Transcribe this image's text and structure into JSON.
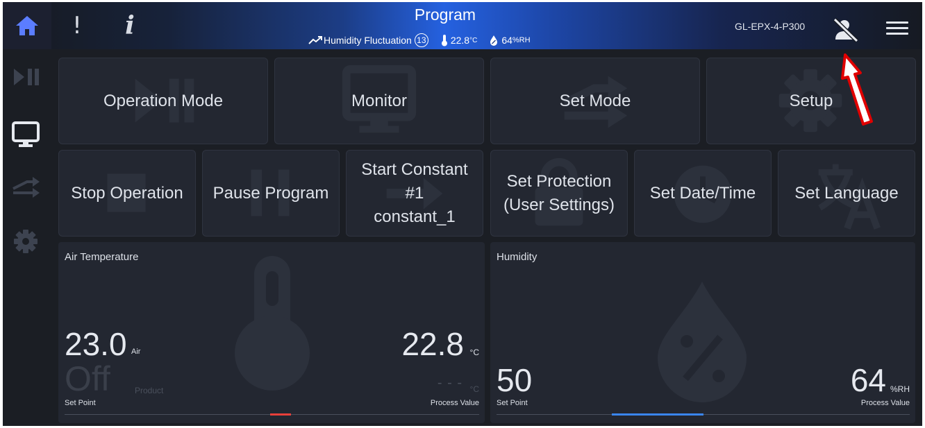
{
  "header": {
    "title": "Program",
    "status": {
      "program_name": "Humidity Fluctuation",
      "step_count": "13",
      "temperature": "22.8",
      "temperature_unit": "°C",
      "humidity": "64",
      "humidity_unit": "%RH"
    },
    "device_name": "GL-EPX-4-P300",
    "alarm_symbol": "!",
    "info_symbol": "i"
  },
  "icons": {
    "home": "home-icon",
    "play_pause": "play-pause-icon",
    "monitor": "monitor-icon",
    "transfer": "transfer-icon",
    "gear": "gear-icon",
    "user_logged_out": "user-slash-icon",
    "menu": "hamburger-menu-icon"
  },
  "tiles": {
    "operation_mode": "Operation Mode",
    "monitor": "Monitor",
    "set_mode": "Set Mode",
    "setup": "Setup",
    "stop_operation": "Stop Operation",
    "pause_program": "Pause Program",
    "start_constant_line1": "Start Constant",
    "start_constant_line2": "#1",
    "start_constant_line3": "constant_1",
    "set_protection_line1": "Set Protection",
    "set_protection_line2": "(User Settings)",
    "set_date_time": "Set Date/Time",
    "set_language": "Set Language"
  },
  "air_temperature": {
    "title": "Air Temperature",
    "set_point": "23.0",
    "set_point_sub": "Air",
    "product_value": "Off",
    "product_label": "Product",
    "process_value": "22.8",
    "process_unit": "°C",
    "product_process_value": "- - -",
    "product_process_unit": "°C",
    "set_point_label": "Set Point",
    "process_value_label": "Process Value",
    "indicator_fraction": 0.05
  },
  "humidity": {
    "title": "Humidity",
    "set_point": "50",
    "process_value": "64",
    "process_unit": "%RH",
    "set_point_label": "Set Point",
    "process_value_label": "Process Value",
    "indicator_fraction": 0.22
  },
  "colors": {
    "accent_blue": "#2d6bff",
    "temperature_indicator": "#e8403a",
    "humidity_indicator": "#3a86f0",
    "annotation_arrow": "#e00000"
  }
}
